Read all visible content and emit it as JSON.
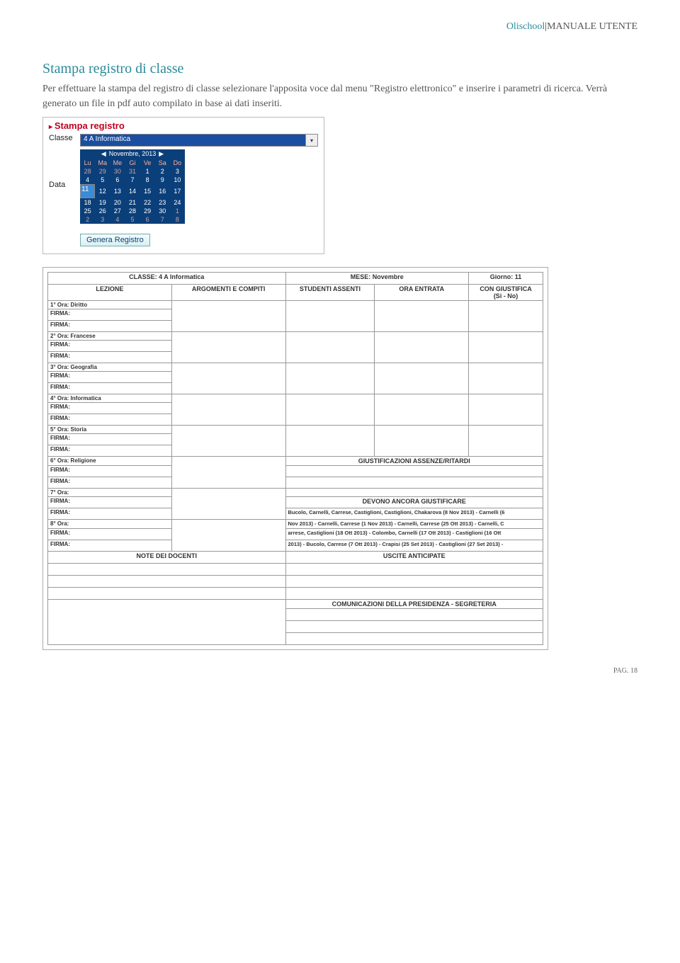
{
  "header": {
    "brand": "Olischool",
    "sep": "|",
    "manual": "MANUALE UTENTE"
  },
  "section": {
    "title": "Stampa registro di classe",
    "body": "Per effettuare la stampa del registro di classe selezionare l'apposita voce dal menu \"Registro elettronico\" e inserire i parametri di ricerca. Verrà generato un file in pdf auto compilato in base ai dati inseriti."
  },
  "panel": {
    "title": "Stampa registro",
    "class_label": "Classe",
    "class_value": "4 A Informatica",
    "date_label": "Data",
    "calendar": {
      "month": "Novembre, 2013",
      "days_header": [
        "Lu",
        "Ma",
        "Me",
        "Gi",
        "Ve",
        "Sa",
        "Do"
      ],
      "weeks": [
        [
          "28",
          "29",
          "30",
          "31",
          "1",
          "2",
          "3"
        ],
        [
          "4",
          "5",
          "6",
          "7",
          "8",
          "9",
          "10"
        ],
        [
          "11",
          "12",
          "13",
          "14",
          "15",
          "16",
          "17"
        ],
        [
          "18",
          "19",
          "20",
          "21",
          "22",
          "23",
          "24"
        ],
        [
          "25",
          "26",
          "27",
          "28",
          "29",
          "30",
          "1"
        ],
        [
          "2",
          "3",
          "4",
          "5",
          "6",
          "7",
          "8"
        ]
      ],
      "selected": "11"
    },
    "generate_button": "Genera Registro"
  },
  "register": {
    "header": {
      "classe": "CLASSE: 4 A Informatica",
      "mese": "MESE: Novembre",
      "giorno": "Giorno: 11"
    },
    "columns": {
      "lezione": "LEZIONE",
      "argomenti": "ARGOMENTI E COMPITI",
      "assenti": "STUDENTI ASSENTI",
      "ora_entr": "ORA ENTRATA",
      "giustifica": "CON GIUSTIFICA",
      "giustifica_sub": "(Si - No)"
    },
    "rows": [
      {
        "lez": "1° Ora: Diritto"
      },
      {
        "lez": "2° Ora: Francese"
      },
      {
        "lez": "3° Ora: Geografia"
      },
      {
        "lez": "4° Ora: Informatica"
      },
      {
        "lez": "5° Ora: Storia"
      },
      {
        "lez": "6° Ora: Religione"
      },
      {
        "lez": "7° Ora:"
      },
      {
        "lez": "8° Ora:"
      }
    ],
    "firma": "FIRMA:",
    "giust_titolo": "GIUSTIFICAZIONI ASSENZE/RITARDI",
    "devono_titolo": "DEVONO ANCORA GIUSTIFICARE",
    "devono_text": [
      "Bucolo, Carnelli, Carrese, Castiglioni, Castiglioni, Chakarova (8 Nov 2013) - Carnelli (6",
      "Nov 2013) - Carnelli, Carrese (1 Nov 2013) - Carnelli, Carrese (25 Ott 2013) - Carnelli, C",
      "arrese, Castiglioni (18 Ott 2013) - Colombo, Carnelli (17 Ott 2013) - Castiglioni (16 Ott",
      "2013) - Bucolo, Carrese (7 Ott 2013) - Crapisi (25 Set 2013) - Castiglioni (27 Set 2013) -"
    ],
    "note_docenti": "NOTE DEI DOCENTI",
    "uscite": "USCITE ANTICIPATE",
    "comunicazioni": "COMUNICAZIONI DELLA PRESIDENZA - SEGRETERIA"
  },
  "footer": {
    "page": "PAG. 18"
  }
}
